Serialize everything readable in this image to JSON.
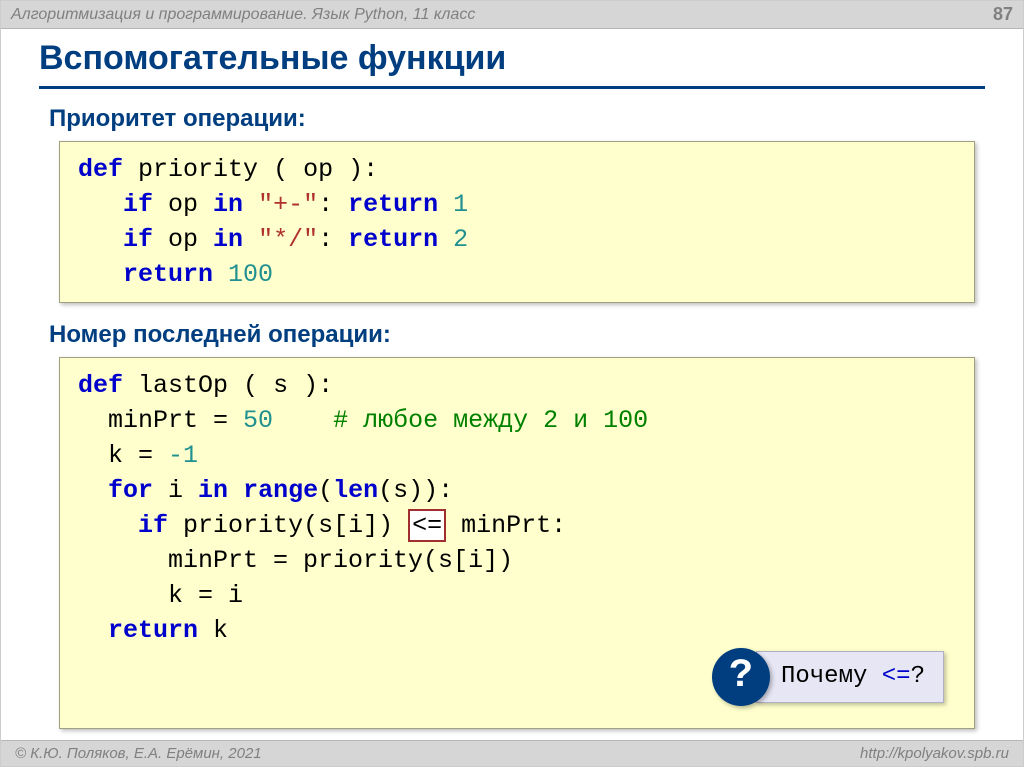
{
  "header": {
    "title": "Алгоритмизация и программирование. Язык Python, 11 класс",
    "page": "87"
  },
  "title": "Вспомогательные функции",
  "sections": {
    "s1": {
      "heading": "Приоритет операции:"
    },
    "s2": {
      "heading": "Номер последней операции:"
    }
  },
  "code1": {
    "def": "def",
    "name": "priority",
    "param": "op",
    "if1": "if",
    "in1": "in",
    "str1": "\"+-\"",
    "ret1": "return",
    "v1": "1",
    "if2": "if",
    "in2": "in",
    "str2": "\"*/\"",
    "ret2": "return",
    "v2": "2",
    "ret3": "return",
    "v3": "100"
  },
  "code2": {
    "def": "def",
    "name": "lastOp",
    "param": "s",
    "assign1_lhs": "minPrt",
    "assign1_val": "50",
    "comment": "# любое между 2 и 100",
    "assign2_lhs": "k",
    "assign2_val": "-1",
    "for": "for",
    "in": "in",
    "range": "range",
    "len": "len",
    "if": "if",
    "call": "priority",
    "op": "<=",
    "rhs": "minPrt",
    "body1": "minPrt = priority(s[i])",
    "body2": "k = i",
    "ret": "return",
    "retval": "k"
  },
  "question": {
    "mark": "?",
    "text_pre": "Почему ",
    "op": "<=",
    "text_post": "?"
  },
  "footer": {
    "left": "© К.Ю. Поляков, Е.А. Ерёмин, 2021",
    "right": "http://kpolyakov.spb.ru"
  }
}
